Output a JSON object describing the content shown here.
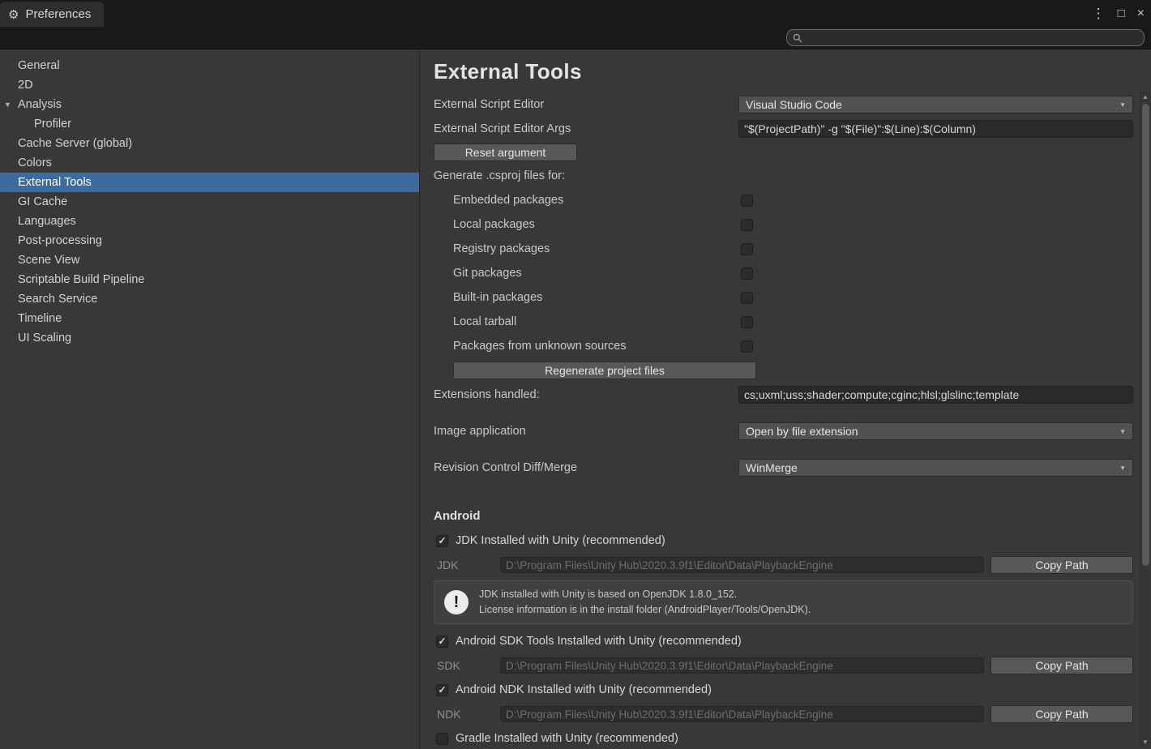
{
  "colors": {
    "selection": "#3e6b9e",
    "panel": "#383838",
    "titlebar": "#191919"
  },
  "icons": {
    "gear": "⚙",
    "menu": "⋮",
    "maximize": "□",
    "close": "×",
    "dropdown_arrow": "▼",
    "expand_triangle": "▼",
    "check": "✓",
    "scroll_up": "▲",
    "scroll_down": "▼",
    "info": "!"
  },
  "window": {
    "tab_title": "Preferences"
  },
  "search": {
    "value": "",
    "placeholder": ""
  },
  "sidebar": {
    "items": [
      {
        "label": "General"
      },
      {
        "label": "2D"
      },
      {
        "label": "Analysis",
        "expanded": true
      },
      {
        "label": "Profiler",
        "indent": 1
      },
      {
        "label": "Cache Server (global)"
      },
      {
        "label": "Colors"
      },
      {
        "label": "External Tools",
        "selected": true
      },
      {
        "label": "GI Cache"
      },
      {
        "label": "Languages"
      },
      {
        "label": "Post-processing"
      },
      {
        "label": "Scene View"
      },
      {
        "label": "Scriptable Build Pipeline"
      },
      {
        "label": "Search Service"
      },
      {
        "label": "Timeline"
      },
      {
        "label": "UI Scaling"
      }
    ]
  },
  "main": {
    "title": "External Tools",
    "script_editor": {
      "label": "External Script Editor",
      "value": "Visual Studio Code"
    },
    "script_editor_args": {
      "label": "External Script Editor Args",
      "value": "\"$(ProjectPath)\" -g \"$(File)\":$(Line):$(Column)"
    },
    "reset_button": "Reset argument",
    "generate_label": "Generate .csproj files for:",
    "generate_options": [
      "Embedded packages",
      "Local packages",
      "Registry packages",
      "Git packages",
      "Built-in packages",
      "Local tarball",
      "Packages from unknown sources"
    ],
    "regenerate_button": "Regenerate project files",
    "extensions": {
      "label": "Extensions handled:",
      "value": "cs;uxml;uss;shader;compute;cginc;hlsl;glslinc;template"
    },
    "image_app": {
      "label": "Image application",
      "value": "Open by file extension"
    },
    "diff_merge": {
      "label": "Revision Control Diff/Merge",
      "value": "WinMerge"
    },
    "android": {
      "section_title": "Android",
      "jdk_toggle": "JDK Installed with Unity (recommended)",
      "jdk": {
        "label": "JDK",
        "path": "D:\\Program Files\\Unity Hub\\2020.3.9f1\\Editor\\Data\\PlaybackEngine",
        "button": "Copy Path"
      },
      "info_line1": "JDK installed with Unity is based on OpenJDK 1.8.0_152.",
      "info_line2": "License information is in the install folder (AndroidPlayer/Tools/OpenJDK).",
      "sdk_toggle": "Android SDK Tools Installed with Unity (recommended)",
      "sdk": {
        "label": "SDK",
        "path": "D:\\Program Files\\Unity Hub\\2020.3.9f1\\Editor\\Data\\PlaybackEngine",
        "button": "Copy Path"
      },
      "ndk_toggle": "Android NDK Installed with Unity (recommended)",
      "ndk": {
        "label": "NDK",
        "path": "D:\\Program Files\\Unity Hub\\2020.3.9f1\\Editor\\Data\\PlaybackEngine",
        "button": "Copy Path"
      },
      "gradle_toggle": "Gradle Installed with Unity (recommended)"
    }
  }
}
